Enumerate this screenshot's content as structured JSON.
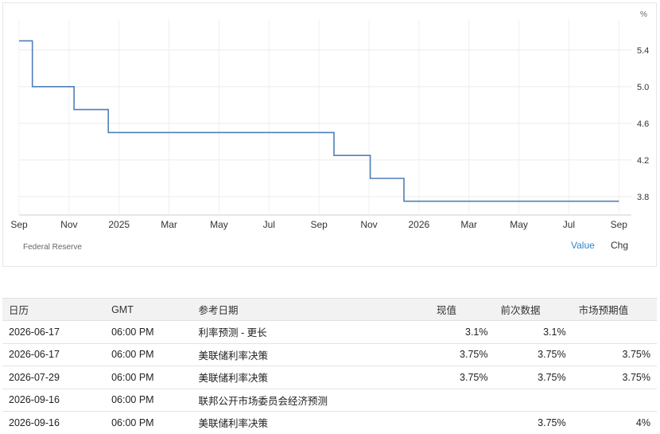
{
  "chart_data": {
    "type": "line",
    "title": "",
    "xlabel": "",
    "ylabel": "%",
    "ylim": [
      3.6,
      5.65
    ],
    "yticks": [
      "5.4",
      "5.0",
      "4.6",
      "4.2",
      "3.8"
    ],
    "xticks": [
      "Sep",
      "Nov",
      "2025",
      "Mar",
      "May",
      "Jul",
      "Sep",
      "Nov",
      "2026",
      "Mar",
      "May",
      "Jul",
      "Sep"
    ],
    "xtick_months": [
      0,
      2,
      4,
      6,
      8,
      10,
      12,
      14,
      16,
      18,
      20,
      22,
      24
    ],
    "grid": true,
    "step": true,
    "series": [
      {
        "name": "",
        "color": "#4f7fb8",
        "points": [
          [
            0,
            5.5
          ],
          [
            0.53,
            5.5
          ],
          [
            0.53,
            5.0
          ],
          [
            2.2,
            5.0
          ],
          [
            2.2,
            4.75
          ],
          [
            3.57,
            4.75
          ],
          [
            3.57,
            4.5
          ],
          [
            12.6,
            4.5
          ],
          [
            12.6,
            4.25
          ],
          [
            14.05,
            4.25
          ],
          [
            14.05,
            4.0
          ],
          [
            15.4,
            4.0
          ],
          [
            15.4,
            3.75
          ],
          [
            24,
            3.75
          ]
        ]
      }
    ]
  },
  "source": "Federal Reserve",
  "toggles": {
    "value": "Value",
    "chg": "Chg"
  },
  "table": {
    "headers": [
      "日历",
      "GMT",
      "参考日期",
      "现值",
      "前次数据",
      "市场预期值"
    ],
    "rows": [
      [
        "2026-06-17",
        "06:00 PM",
        "利率预测 - 更长",
        "3.1%",
        "3.1%",
        ""
      ],
      [
        "2026-06-17",
        "06:00 PM",
        "美联储利率决策",
        "3.75%",
        "3.75%",
        "3.75%"
      ],
      [
        "2026-07-29",
        "06:00 PM",
        "美联储利率决策",
        "3.75%",
        "3.75%",
        "3.75%"
      ],
      [
        "2026-09-16",
        "06:00 PM",
        "联邦公开市场委员会经济预测",
        "",
        "",
        ""
      ],
      [
        "2026-09-16",
        "06:00 PM",
        "美联储利率决策",
        "",
        "3.75%",
        "4%"
      ]
    ]
  }
}
